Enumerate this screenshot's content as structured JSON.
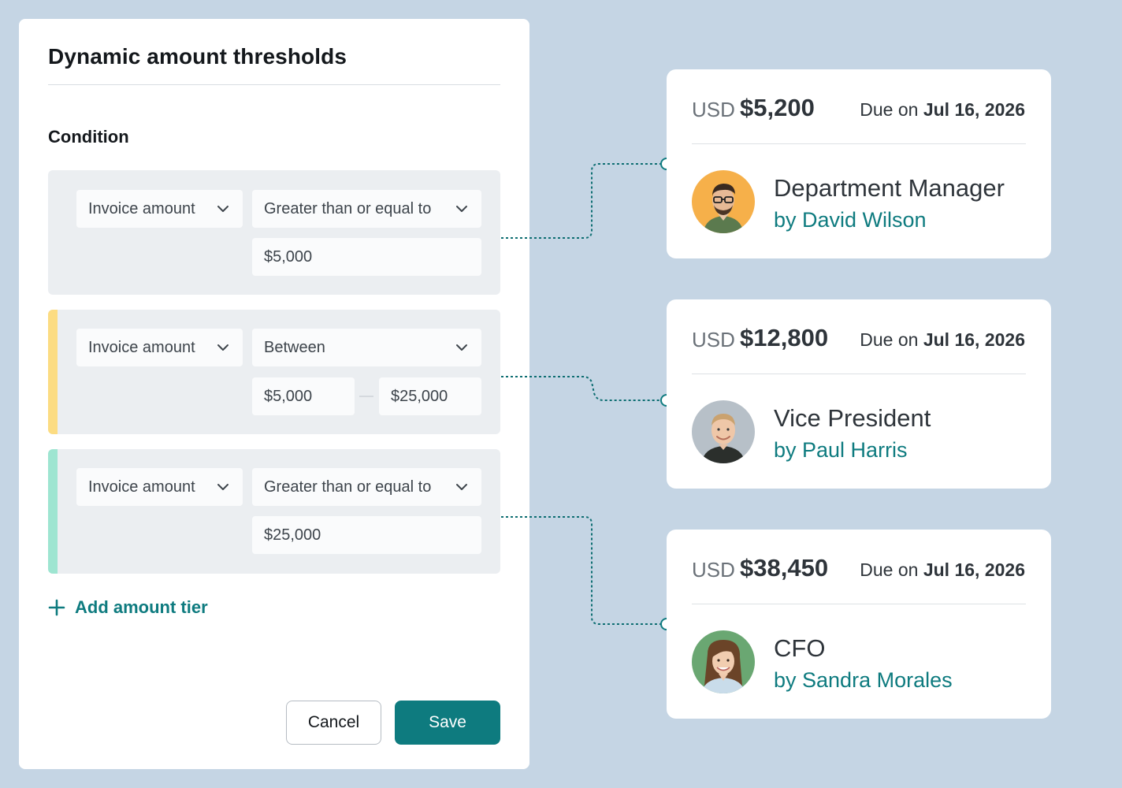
{
  "panel": {
    "title": "Dynamic amount thresholds",
    "condition_label": "Condition",
    "tiers": [
      {
        "field": "Invoice amount",
        "operator": "Greater than or equal to",
        "value": "$5,000",
        "accent_color": ""
      },
      {
        "field": "Invoice amount",
        "operator": "Between",
        "value_min": "$5,000",
        "value_max": "$25,000",
        "accent_color": "#fcdc82"
      },
      {
        "field": "Invoice amount",
        "operator": "Greater than or equal to",
        "value": "$25,000",
        "accent_color": "#9ee5d1"
      }
    ],
    "add_tier_label": "Add amount tier",
    "cancel_label": "Cancel",
    "save_label": "Save"
  },
  "cards": [
    {
      "currency": "USD",
      "amount": "$5,200",
      "due_prefix": "Due on",
      "due_date": "Jul 16, 2026",
      "role": "Department Manager",
      "approver": "by David Wilson",
      "avatar_bg": "#f6b04a"
    },
    {
      "currency": "USD",
      "amount": "$12,800",
      "due_prefix": "Due on",
      "due_date": "Jul 16, 2026",
      "role": "Vice President",
      "approver": "by Paul Harris",
      "avatar_bg": "#b7c0c8"
    },
    {
      "currency": "USD",
      "amount": "$38,450",
      "due_prefix": "Due on",
      "due_date": "Jul 16, 2026",
      "role": "CFO",
      "approver": "by Sandra Morales",
      "avatar_bg": "#6aa772"
    }
  ],
  "colors": {
    "brand": "#0e7b7f",
    "background": "#c5d5e4",
    "tier_bg": "#ebeef1"
  }
}
